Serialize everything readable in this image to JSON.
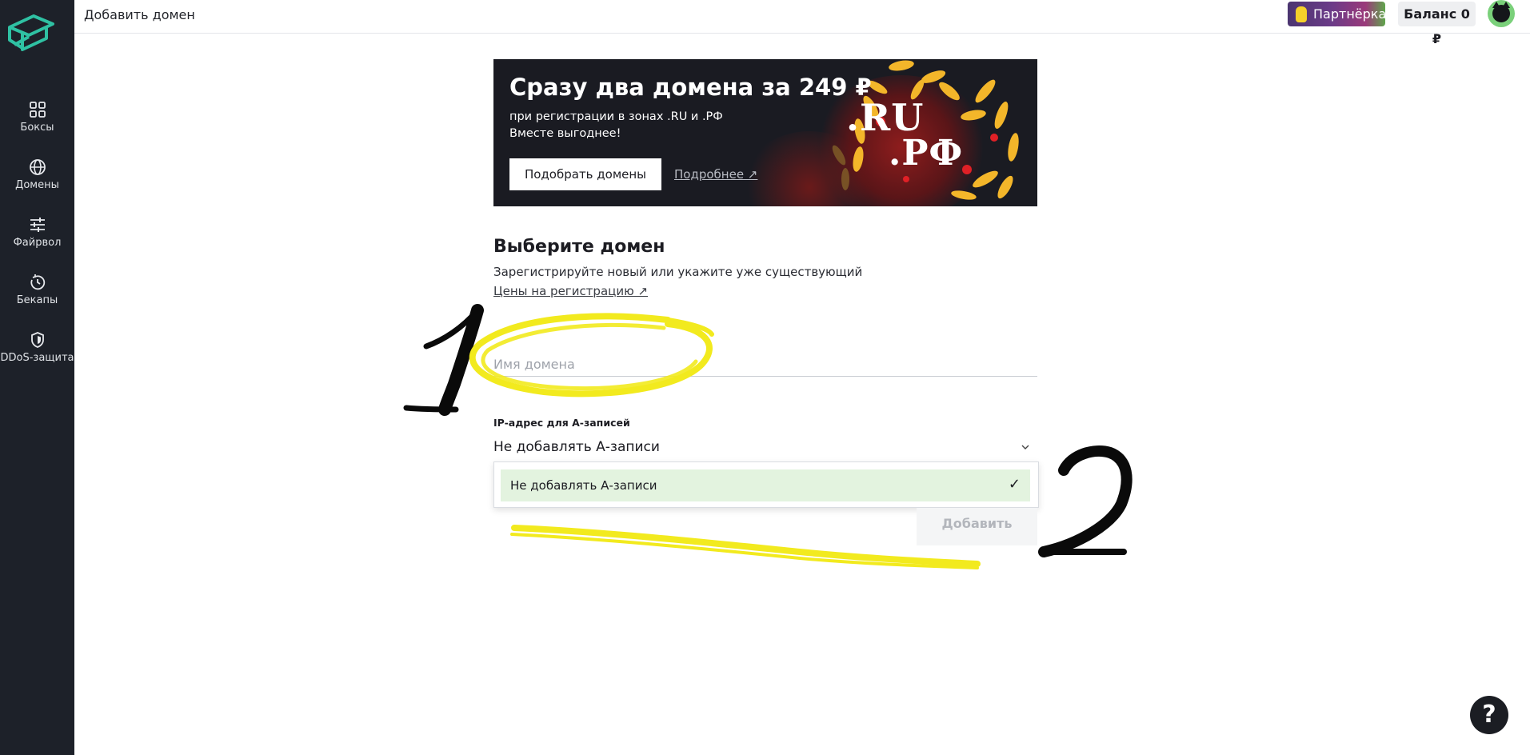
{
  "sidebar": {
    "items": [
      {
        "label": "Боксы",
        "icon": "boxes-grid-icon"
      },
      {
        "label": "Домены",
        "icon": "globe-icon"
      },
      {
        "label": "Файрвол",
        "icon": "sliders-icon"
      },
      {
        "label": "Бекапы",
        "icon": "backup-clock-icon"
      },
      {
        "label": "DDoS-защита",
        "icon": "shield-icon"
      }
    ]
  },
  "header": {
    "title": "Добавить домен",
    "partner_label": "Партнёрка",
    "balance_label": "Баланс 0 ₽"
  },
  "banner": {
    "title": "Сразу два домена за 249 ₽",
    "subtitle_line1": "при регистрации в зонах .RU и .РФ",
    "subtitle_line2": "Вместе выгоднее!",
    "button_label": "Подобрать домены",
    "link_label": "Подробнее ↗",
    "art_ru": ".RU",
    "art_rf": ".РФ"
  },
  "form": {
    "title": "Выберите домен",
    "description": "Зарегистрируйте новый или укажите уже существующий",
    "prices_link": "Цены на регистрацию ↗",
    "domain_placeholder": "Имя домена",
    "domain_value": "",
    "ip_label": "IP-адрес для А-записей",
    "ip_selected": "Не добавлять А-записи",
    "ip_options": [
      "Не добавлять А-записи"
    ],
    "add_button": "Добавить"
  },
  "annotations": {
    "mark1": "1",
    "mark2": "2",
    "highlight_color": "#f2ea1e"
  },
  "help_label": "?",
  "colors": {
    "sidebar_bg": "#1d2129",
    "accent": "#2fc1a3",
    "selected_option_bg": "#e3f3df",
    "banner_bg": "#1a1b22"
  }
}
